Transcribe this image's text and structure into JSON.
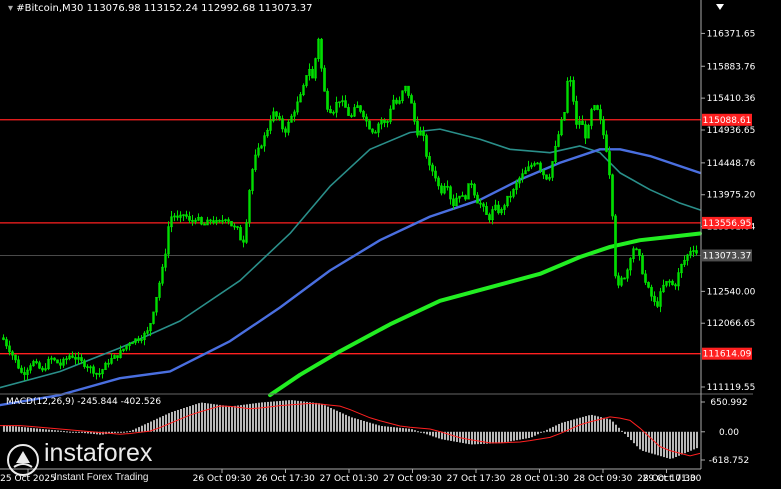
{
  "header": {
    "symbol": "#Bitcoin,M30",
    "ohlc": [
      "113076.98",
      "113152.24",
      "112992.68",
      "113073.37"
    ]
  },
  "macd": {
    "label": "MACD(12,26,9)",
    "values": [
      "-245.844",
      "-402.526"
    ],
    "ticks": [
      "650.992",
      "0.00",
      "-618.752"
    ]
  },
  "logo": {
    "name": "instaforex",
    "tagline": "Instant Forex Trading"
  },
  "colors": {
    "background": "#000000",
    "candle": "#00dd00",
    "ma_fast": "#2a8f8a",
    "ma_mid": "#4a6fe0",
    "ma_slow": "#22ee22",
    "resistance": "#ff2020",
    "price_tag": "#4d4d4d",
    "macd_hist": "#b8b8b8",
    "macd_signal": "#ff2020"
  },
  "chart_data": {
    "type": "candlestick",
    "symbol": "#Bitcoin",
    "timeframe": "M30",
    "y_ticks": [
      116371.65,
      115883.76,
      115410.36,
      114936.65,
      114448.76,
      113975.2,
      113501.64,
      112540.0,
      112066.65,
      111119.55
    ],
    "y_tick_labels": [
      "116371.65",
      "115883.76",
      "115410.36",
      "114936.65",
      "114448.76",
      "113975.20",
      "113501.64",
      "112540.00",
      "112066.65",
      "111119.55"
    ],
    "ylim": [
      111045,
      116660
    ],
    "x_tick_labels": [
      "25 Oct 2025",
      "26 Oct 09:30",
      "26 Oct 17:30",
      "27 Oct 01:30",
      "27 Oct 09:30",
      "27 Oct 17:30",
      "28 Oct 01:30",
      "28 Oct 09:30",
      "28 Oct 17:30",
      "29 Oct 01:30"
    ],
    "levels": [
      {
        "value": 115088.61,
        "label": "115088.61"
      },
      {
        "value": 113556.95,
        "label": "113556.95"
      },
      {
        "value": 111614.09,
        "label": "111614.09"
      }
    ],
    "current_price": {
      "value": 113073.37,
      "label": "113073.37"
    },
    "close_path": [
      [
        0,
        111900
      ],
      [
        12,
        111600
      ],
      [
        22,
        111300
      ],
      [
        32,
        111500
      ],
      [
        42,
        111350
      ],
      [
        50,
        111550
      ],
      [
        60,
        111450
      ],
      [
        70,
        111600
      ],
      [
        80,
        111500
      ],
      [
        90,
        111400
      ],
      [
        98,
        111300
      ],
      [
        108,
        111500
      ],
      [
        118,
        111600
      ],
      [
        130,
        111800
      ],
      [
        140,
        111850
      ],
      [
        148,
        111950
      ],
      [
        152,
        112200
      ],
      [
        158,
        112600
      ],
      [
        164,
        113000
      ],
      [
        168,
        113500
      ],
      [
        172,
        113700
      ],
      [
        178,
        113600
      ],
      [
        184,
        113700
      ],
      [
        190,
        113550
      ],
      [
        196,
        113650
      ],
      [
        202,
        113500
      ],
      [
        210,
        113600
      ],
      [
        218,
        113550
      ],
      [
        226,
        113650
      ],
      [
        232,
        113500
      ],
      [
        238,
        113450
      ],
      [
        242,
        113200
      ],
      [
        246,
        113600
      ],
      [
        250,
        114200
      ],
      [
        254,
        114500
      ],
      [
        260,
        114700
      ],
      [
        266,
        114900
      ],
      [
        272,
        115200
      ],
      [
        278,
        115100
      ],
      [
        284,
        114900
      ],
      [
        290,
        115100
      ],
      [
        296,
        115300
      ],
      [
        302,
        115500
      ],
      [
        308,
        115900
      ],
      [
        312,
        115700
      ],
      [
        318,
        116300
      ],
      [
        322,
        115700
      ],
      [
        326,
        115300
      ],
      [
        332,
        115200
      ],
      [
        338,
        115400
      ],
      [
        344,
        115300
      ],
      [
        350,
        115100
      ],
      [
        356,
        115300
      ],
      [
        362,
        115200
      ],
      [
        368,
        115000
      ],
      [
        374,
        114900
      ],
      [
        380,
        115100
      ],
      [
        386,
        115000
      ],
      [
        392,
        115400
      ],
      [
        398,
        115300
      ],
      [
        404,
        115600
      ],
      [
        410,
        115400
      ],
      [
        416,
        114900
      ],
      [
        422,
        114900
      ],
      [
        428,
        114400
      ],
      [
        434,
        114300
      ],
      [
        440,
        114000
      ],
      [
        446,
        114200
      ],
      [
        452,
        113800
      ],
      [
        458,
        114000
      ],
      [
        464,
        113900
      ],
      [
        470,
        114200
      ],
      [
        476,
        113900
      ],
      [
        482,
        113800
      ],
      [
        488,
        113600
      ],
      [
        494,
        113800
      ],
      [
        500,
        113700
      ],
      [
        506,
        113900
      ],
      [
        512,
        114000
      ],
      [
        518,
        114200
      ],
      [
        524,
        114300
      ],
      [
        530,
        114400
      ],
      [
        536,
        114500
      ],
      [
        542,
        114300
      ],
      [
        548,
        114200
      ],
      [
        554,
        114600
      ],
      [
        560,
        115000
      ],
      [
        564,
        115200
      ],
      [
        568,
        115800
      ],
      [
        572,
        115500
      ],
      [
        576,
        115000
      ],
      [
        580,
        115100
      ],
      [
        586,
        114800
      ],
      [
        592,
        115300
      ],
      [
        598,
        115200
      ],
      [
        604,
        114800
      ],
      [
        608,
        114500
      ],
      [
        612,
        113700
      ],
      [
        616,
        112500
      ],
      [
        620,
        112700
      ],
      [
        626,
        112800
      ],
      [
        632,
        113200
      ],
      [
        638,
        113100
      ],
      [
        644,
        112700
      ],
      [
        650,
        112500
      ],
      [
        656,
        112300
      ],
      [
        662,
        112600
      ],
      [
        668,
        112700
      ],
      [
        674,
        112600
      ],
      [
        680,
        112900
      ],
      [
        686,
        113050
      ],
      [
        692,
        113200
      ],
      [
        698,
        113073
      ]
    ],
    "series": [
      {
        "color": "#2a8f8a",
        "points": [
          [
            0,
            111110
          ],
          [
            60,
            111350
          ],
          [
            120,
            111700
          ],
          [
            180,
            112100
          ],
          [
            240,
            112700
          ],
          [
            290,
            113400
          ],
          [
            330,
            114100
          ],
          [
            370,
            114650
          ],
          [
            410,
            114900
          ],
          [
            440,
            114950
          ],
          [
            480,
            114800
          ],
          [
            510,
            114650
          ],
          [
            550,
            114600
          ],
          [
            580,
            114700
          ],
          [
            600,
            114600
          ],
          [
            620,
            114300
          ],
          [
            650,
            114050
          ],
          [
            680,
            113850
          ],
          [
            700,
            113750
          ]
        ]
      },
      {
        "color": "#4a6fe0",
        "points": [
          [
            0,
            110850
          ],
          [
            60,
            111000
          ],
          [
            120,
            111250
          ],
          [
            170,
            111350
          ],
          [
            230,
            111800
          ],
          [
            280,
            112300
          ],
          [
            330,
            112850
          ],
          [
            380,
            113300
          ],
          [
            430,
            113650
          ],
          [
            480,
            113900
          ],
          [
            520,
            114200
          ],
          [
            560,
            114450
          ],
          [
            600,
            114650
          ],
          [
            620,
            114650
          ],
          [
            650,
            114550
          ],
          [
            680,
            114400
          ],
          [
            700,
            114300
          ]
        ]
      },
      {
        "color": "#22ee22",
        "points": [
          [
            270,
            111000
          ],
          [
            300,
            111300
          ],
          [
            340,
            111650
          ],
          [
            390,
            112050
          ],
          [
            440,
            112400
          ],
          [
            490,
            112600
          ],
          [
            540,
            112800
          ],
          [
            580,
            113050
          ],
          [
            610,
            113200
          ],
          [
            640,
            113300
          ],
          [
            670,
            113350
          ],
          [
            700,
            113400
          ]
        ]
      }
    ]
  }
}
